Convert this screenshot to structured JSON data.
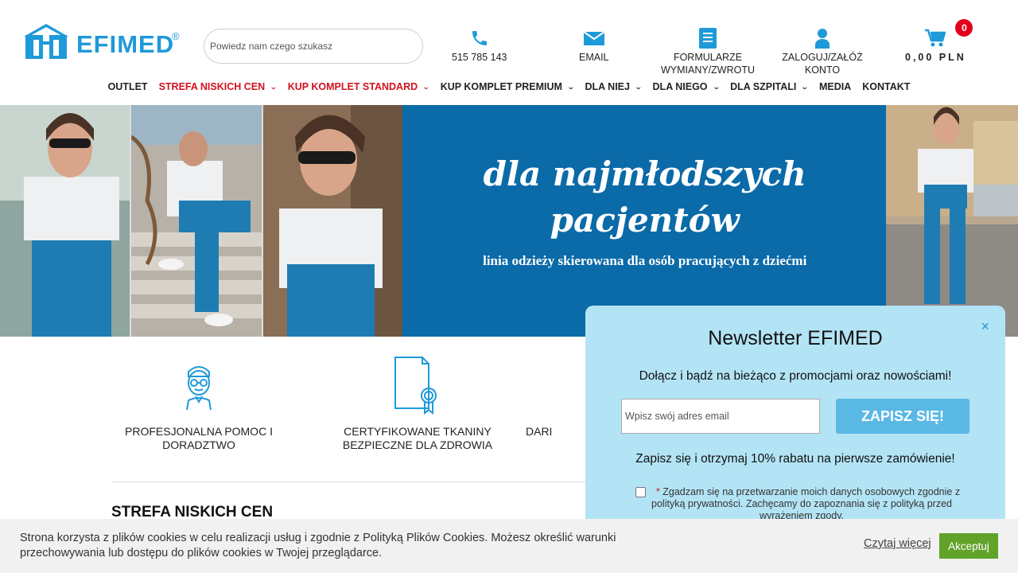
{
  "brand": {
    "name": "EFIMED",
    "registered": "®",
    "accent": "#1e9ad9"
  },
  "search": {
    "placeholder": "Powiedz nam czego szukasz"
  },
  "header_items": {
    "phone": {
      "icon": "phone-icon",
      "label": "515 785 143"
    },
    "email": {
      "icon": "envelope-icon",
      "label": "EMAIL"
    },
    "forms": {
      "icon": "document-icon",
      "label": "FORMULARZE WYMIANY/ZWROTU"
    },
    "account": {
      "icon": "user-icon",
      "label": "ZALOGUJ/ZAŁÓŻ KONTO"
    },
    "cart": {
      "icon": "cart-icon",
      "count": "0",
      "total": "0,00 PLN"
    }
  },
  "nav": [
    {
      "label": "OUTLET",
      "red": false,
      "dropdown": false
    },
    {
      "label": "STREFA NISKICH CEN",
      "red": true,
      "dropdown": true
    },
    {
      "label": "KUP KOMPLET STANDARD",
      "red": true,
      "dropdown": true
    },
    {
      "label": "KUP KOMPLET PREMIUM",
      "red": false,
      "dropdown": true
    },
    {
      "label": "DLA NIEJ",
      "red": false,
      "dropdown": true
    },
    {
      "label": "DLA NIEGO",
      "red": false,
      "dropdown": true
    },
    {
      "label": "DLA SZPITALI",
      "red": false,
      "dropdown": true
    },
    {
      "label": "MEDIA",
      "red": false,
      "dropdown": false
    },
    {
      "label": "KONTAKT",
      "red": false,
      "dropdown": false
    }
  ],
  "hero": {
    "title_line1": "dla najmłodszych",
    "title_line2": "pacjentów",
    "subtitle": "linia odzieży skierowana dla osób pracujących z dziećmi",
    "bg_color": "#0b6aa8"
  },
  "features": [
    {
      "icon": "doctor-icon",
      "label": "PROFESJONALNA POMOC I DORADZTWO"
    },
    {
      "icon": "certificate-icon",
      "label": "CERTYFIKOWANE TKANINY BEZPIECZNE DLA ZDROWIA"
    },
    {
      "icon": "gift-icon",
      "label": "DARI"
    }
  ],
  "section": {
    "title": "STREFA NISKICH CEN"
  },
  "newsletter": {
    "title": "Newsletter EFIMED",
    "text1": "Dołącz i bądź na bieżąco z promocjami oraz nowościami!",
    "email_placeholder": "Wpisz swój adres email",
    "button": "ZAPISZ SIĘ!",
    "text2": "Zapisz się i otrzymaj 10% rabatu na pierwsze zamówienie!",
    "consent_star": "*",
    "consent": "Zgadzam się na przetwarzanie moich danych osobowych zgodnie z polityką prywatności. Zachęcamy do zapoznania się z polityką przed wyrażeniem zgody.",
    "close": "×"
  },
  "cookie": {
    "text": "Strona korzysta z plików cookies w celu realizacji usług i zgodnie z Polityką Plików Cookies. Możesz określić warunki przechowywania lub dostępu do plików cookies w Twojej przeglądarce.",
    "read_more": "Czytaj więcej",
    "accept": "Akceptuj"
  }
}
